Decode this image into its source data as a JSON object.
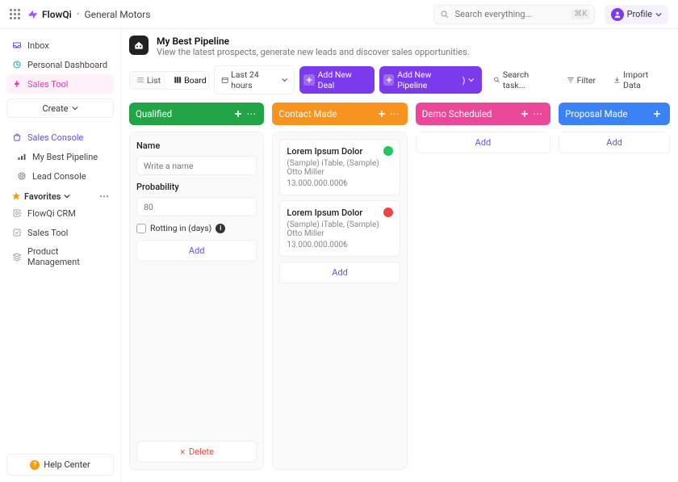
{
  "brand": "FlowQi",
  "breadcrumb": "General Motors",
  "search": {
    "placeholder": "Search everything...",
    "kbd": "⌘K"
  },
  "profile": {
    "label": "Profile"
  },
  "sidebar": {
    "inbox": "Inbox",
    "dashboard": "Personal Dashboard",
    "salesTool": "Sales Tool",
    "create": "Create",
    "consoleHeader": "Sales Console",
    "pipeline": "My Best Pipeline",
    "leadConsole": "Lead Console",
    "favHeader": "Favorites",
    "fav": [
      "FlowQi CRM",
      "Sales Tool",
      "Product Management"
    ],
    "help": "Help Center"
  },
  "page": {
    "title": "My Best Pipeline",
    "subtitle": "View the latest prospects, generate new leads and discover sales opportunities."
  },
  "toolbar": {
    "list": "List",
    "board": "Board",
    "range": "Last 24 hours",
    "addDeal": "Add New Deal",
    "addPipeline": "Add New Pipeline",
    "search": "Search task...",
    "filter": "Filter",
    "import": "Import Data"
  },
  "columns": {
    "qualified": {
      "title": "Qualified",
      "nameLabel": "Name",
      "namePlaceholder": "Write a name",
      "probLabel": "Probability",
      "probPlaceholder": "80",
      "rotting": "Rotting in (days)",
      "add": "Add",
      "delete": "Delete"
    },
    "contact": {
      "title": "Contact Made",
      "cards": [
        {
          "title": "Lorem Ipsum Dolor",
          "sub": "(Sample) iTable, (Sample) Otto Miller",
          "amount": "13.000.000.000₺",
          "status": "ok"
        },
        {
          "title": "Lorem Ipsum Dolor",
          "sub": "(Sample) iTable, (Sample) Otto Miller",
          "amount": "13.000.000.000₺",
          "status": "bad"
        }
      ],
      "add": "Add"
    },
    "demo": {
      "title": "Demo Scheduled",
      "add": "Add"
    },
    "proposal": {
      "title": "Proposal Made",
      "add": "Add"
    }
  }
}
